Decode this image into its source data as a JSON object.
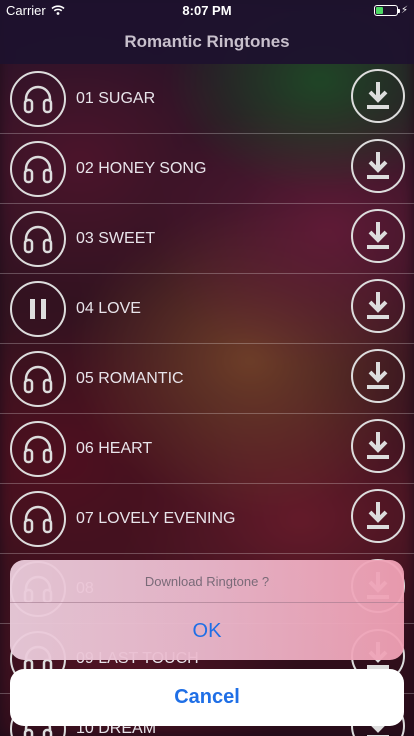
{
  "status_bar": {
    "carrier": "Carrier",
    "time": "8:07 PM"
  },
  "nav": {
    "title": "Romantic Ringtones"
  },
  "ringtones": [
    {
      "title": "01 SUGAR",
      "state": "headphones"
    },
    {
      "title": "02 HONEY SONG",
      "state": "headphones"
    },
    {
      "title": "03 SWEET",
      "state": "headphones"
    },
    {
      "title": "04 LOVE",
      "state": "pause"
    },
    {
      "title": "05 ROMANTIC",
      "state": "headphones"
    },
    {
      "title": "06 HEART",
      "state": "headphones"
    },
    {
      "title": "07 LOVELY EVENING",
      "state": "headphones"
    },
    {
      "title": "08",
      "state": "headphones"
    },
    {
      "title": "09 LAST TOUCH",
      "state": "headphones"
    },
    {
      "title": "10 DREAM",
      "state": "headphones"
    }
  ],
  "alert": {
    "message": "Download Ringtone ?",
    "ok_label": "OK",
    "cancel_label": "Cancel"
  },
  "colors": {
    "accent": "#1f6fe6",
    "battery": "#4cd964",
    "icon_stroke": "#dddddd"
  },
  "icons": {
    "play_state": "headphones-icon",
    "playing_state": "pause-icon",
    "download": "download-icon"
  }
}
